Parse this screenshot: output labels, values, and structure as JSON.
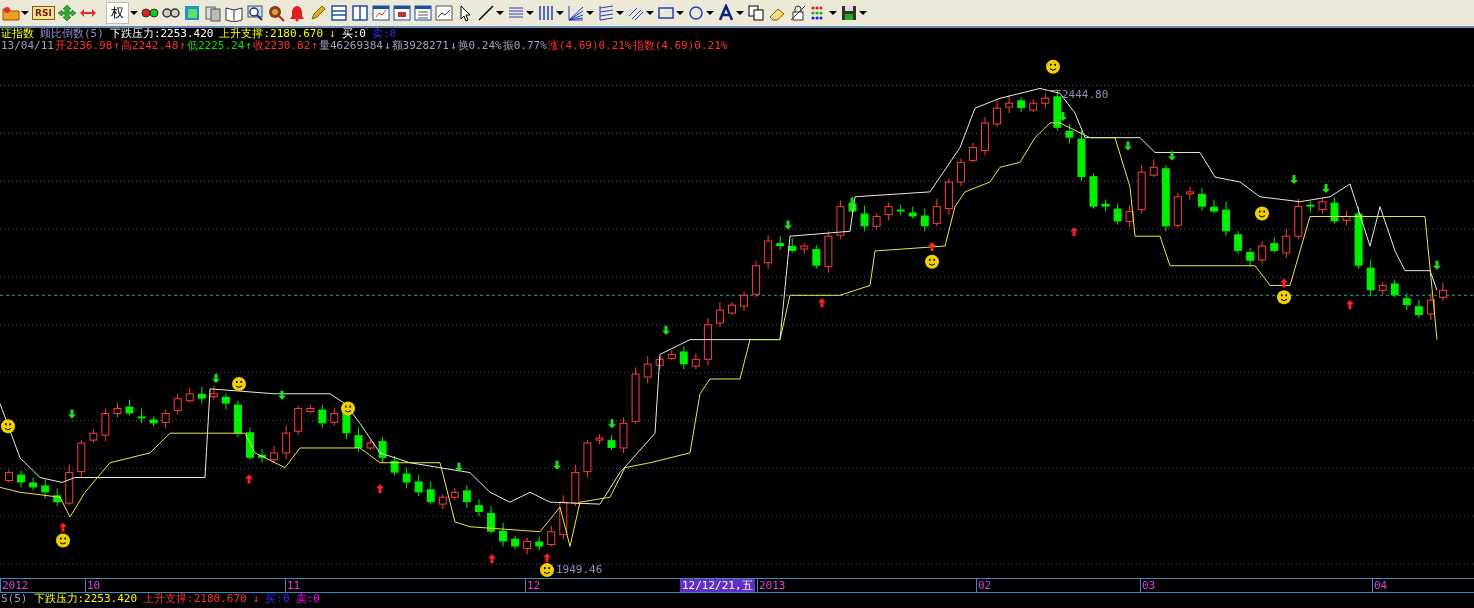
{
  "toolbar": {
    "rsi_label": "RSI",
    "rights_label": "权"
  },
  "indicator_bar": [
    {
      "text": "证指数",
      "kind": "title"
    },
    {
      "text": "顾比倒数(5)",
      "kind": "name"
    },
    {
      "text": "下跌压力:2253.420",
      "kind": "white"
    },
    {
      "text": "上升支撑:2180.670",
      "kind": "title"
    },
    {
      "text": "↓",
      "kind": "flag"
    },
    {
      "text": "买:0",
      "kind": "white"
    },
    {
      "text": "卖:0",
      "kind": "sell"
    }
  ],
  "quote_bar": [
    {
      "text": "13/04/11",
      "kind": "neutral"
    },
    {
      "text": "开2236.98",
      "kind": "rise"
    },
    {
      "text": "↑",
      "kind": "rise"
    },
    {
      "text": "高2242.48",
      "kind": "rise"
    },
    {
      "text": "↑",
      "kind": "rise"
    },
    {
      "text": "低2225.24",
      "kind": "fall"
    },
    {
      "text": "↑",
      "kind": "fall"
    },
    {
      "text": "收2230.82",
      "kind": "rise"
    },
    {
      "text": "↑",
      "kind": "rise"
    },
    {
      "text": "量46269384",
      "kind": "neutral"
    },
    {
      "text": "↓",
      "kind": "neutral"
    },
    {
      "text": "额3928271",
      "kind": "neutral"
    },
    {
      "text": "↓",
      "kind": "neutral"
    },
    {
      "text": "换0.24%",
      "kind": "neutral"
    },
    {
      "text": "振0.77%",
      "kind": "neutral"
    },
    {
      "text": "涨(4.69)0.21%",
      "kind": "rise"
    },
    {
      "text": "指数(4.69)0.21%",
      "kind": "rise"
    }
  ],
  "chart": {
    "high_label": "2444.80",
    "low_label": "1949.46"
  },
  "time_axis": {
    "labels": [
      "2012",
      "10",
      "11",
      "12",
      "2013",
      "02",
      "03",
      "04"
    ],
    "cursor_label": "12/12/21,五"
  },
  "bottom_bar": [
    {
      "text": "S(5)",
      "kind": "neutral"
    },
    {
      "text": "下跌压力:2253.420",
      "kind": "title"
    },
    {
      "text": "上升支撑:2180.670",
      "kind": "rise"
    },
    {
      "text": "↓",
      "kind": "rise"
    },
    {
      "text": "买:0",
      "kind": "sell"
    },
    {
      "text": "卖:0",
      "kind": "magenta"
    }
  ]
}
